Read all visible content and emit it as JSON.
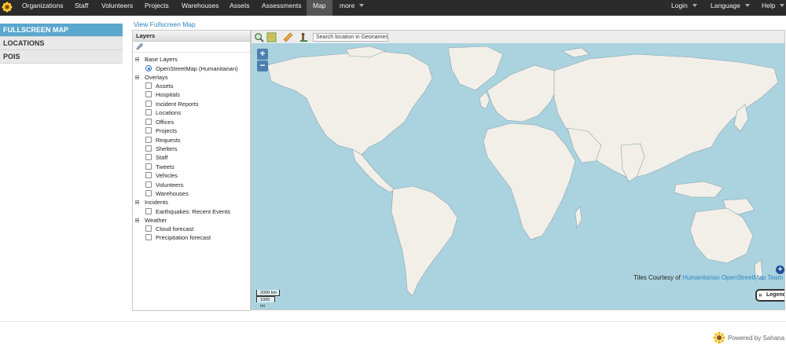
{
  "nav": {
    "items": [
      {
        "label": "Organizations"
      },
      {
        "label": "Staff"
      },
      {
        "label": "Volunteers"
      },
      {
        "label": "Projects"
      },
      {
        "label": "Warehouses"
      },
      {
        "label": "Assets"
      },
      {
        "label": "Assessments"
      },
      {
        "label": "Map"
      },
      {
        "label": "more"
      }
    ],
    "active": "Map",
    "right": [
      {
        "label": "Login"
      },
      {
        "label": "Language"
      },
      {
        "label": "Help"
      }
    ]
  },
  "sidebar": {
    "items": [
      {
        "label": "FULLSCREEN MAP",
        "active": true
      },
      {
        "label": "LOCATIONS",
        "active": false
      },
      {
        "label": "POIS",
        "active": false
      }
    ]
  },
  "view_fullscreen_link": "View Fullscreen Map",
  "layers": {
    "title": "Layers",
    "base_layers": {
      "label": "Base Layers",
      "items": [
        {
          "label": "OpenStreetMap (Humanitarian)",
          "selected": true
        }
      ]
    },
    "overlays": {
      "label": "Overlays",
      "items": [
        {
          "label": "Assets"
        },
        {
          "label": "Hospitals"
        },
        {
          "label": "Incident Reports"
        },
        {
          "label": "Locations"
        },
        {
          "label": "Offices"
        },
        {
          "label": "Projects"
        },
        {
          "label": "Requests"
        },
        {
          "label": "Shelters"
        },
        {
          "label": "Staff"
        },
        {
          "label": "Tweets"
        },
        {
          "label": "Vehicles"
        },
        {
          "label": "Volunteers"
        },
        {
          "label": "Warehouses"
        }
      ]
    },
    "incidents": {
      "label": "Incidents",
      "items": [
        {
          "label": "Earthquakes: Recent Events"
        }
      ]
    },
    "weather": {
      "label": "Weather",
      "items": [
        {
          "label": "Cloud forecast"
        },
        {
          "label": "Precipitation forecast"
        }
      ]
    }
  },
  "map": {
    "search_placeholder": "Search location in Geonames",
    "zoom_in": "+",
    "zoom_out": "−",
    "attribution_prefix": "Tiles Courtesy of ",
    "attribution_link": "Humanitarian OpenStreetMap Team",
    "scale_km": "2000 km",
    "scale_mi": "1000 mi",
    "legend_label": "Legend",
    "legend_arrow": "»",
    "expand_icon_text": "+",
    "water_color": "#aad3df",
    "land_color": "#f2efe9"
  },
  "footer": {
    "powered_by": "Powered by Sahana"
  }
}
